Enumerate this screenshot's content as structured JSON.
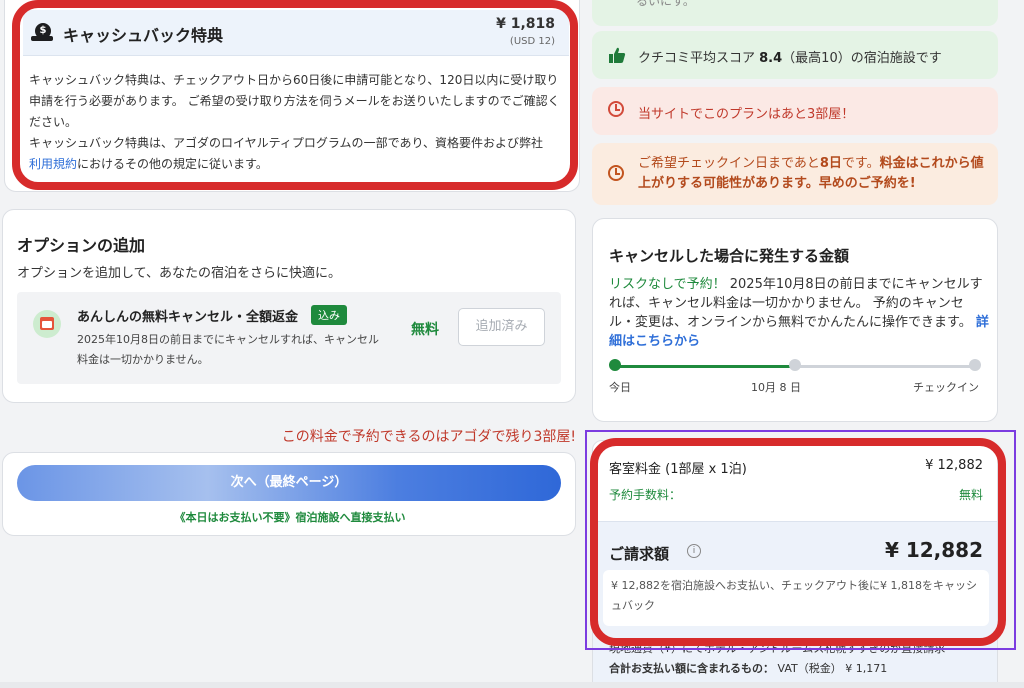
{
  "cashback": {
    "title": "キャッシュバック特典",
    "amount": "¥ 1,818",
    "amount_usd": "(USD 12)",
    "para1": "キャッシュバック特典は、チェックアウト日から60日後に申請可能となり、120日以内に受け取り申請を行う必要があります。 ご希望の受け取り方法を伺うメールをお送りいたしますのでご確認ください。",
    "para2_prefix": "キャッシュバック特典は、アゴダのロイヤルティプログラムの一部であり、資格要件および弊社",
    "para2_link": "利用規約",
    "para2_suffix": "におけるその他の規定に従います。",
    "icon": "cashback-coin-icon"
  },
  "options": {
    "title": "オプションの追加",
    "subtitle": "オプションを追加して、あなたの宿泊をさらに快適に。",
    "item": {
      "name": "あんしんの無料キャンセル・全額返金",
      "badge": "込み",
      "desc": "2025年10月8日の前日までにキャンセルすれば、キャンセル料金は一切かかりません。",
      "price": "無料",
      "button": "追加済み",
      "icon": "calendar-icon"
    }
  },
  "urgency": "この料金で予約できるのはアゴダで残り3部屋!",
  "next": {
    "button": "次へ（最終ページ）",
    "note": "《本日はお支払い不要》宿泊施設へ直接支払い"
  },
  "notices": {
    "top_partial": "るいにす。",
    "review_prefix": "クチコミ平均スコア ",
    "review_score": "8.4",
    "review_suffix": "（最高10）の宿泊施設です",
    "rooms_left": "当サイトでこのプランはあと3部屋！",
    "checkin_prefix": "ご希望チェックイン日まであと",
    "checkin_days": "8日",
    "checkin_mid": "です。",
    "checkin_warn": "料金はこれから値上がりする可能性があります。早めのご予約を!"
  },
  "cancellation": {
    "title": "キャンセルした場合に発生する金額",
    "ok": "リスクなしで予約！",
    "body": " 2025年10月8日の前日までにキャンセルすれば、キャンセル料金は一切かかりません。 予約のキャンセル・変更は、オンラインから無料でかんたんに操作できます。",
    "link": "詳細はこちらから",
    "timeline": [
      "今日",
      "10月 8 日",
      "チェックイン"
    ],
    "progress": 0.5
  },
  "price": {
    "room_label": "客室料金 (1部屋 x 1泊)",
    "room_value": "¥ 12,882",
    "fee_label": "予約手数料：",
    "fee_value": "無料",
    "total_label": "ご請求額",
    "total_value": "¥ 12,882",
    "note": "¥ 12,882を宿泊施設へお支払い、チェックアウト後に¥ 1,818をキャッシュバック",
    "local": "現地通貨（¥）にてホテル・アンドルームス札幌すすきのが直接請求",
    "vat_label": "合計お支払い額に含まれるもの：",
    "vat_value": "VAT（税金） ¥ 1,171"
  },
  "colors": {
    "annotation_red": "#d72b2b",
    "annotation_purple": "#7c3ce0",
    "accent_green": "#1f8a3d",
    "link_blue": "#2f6fd8"
  }
}
